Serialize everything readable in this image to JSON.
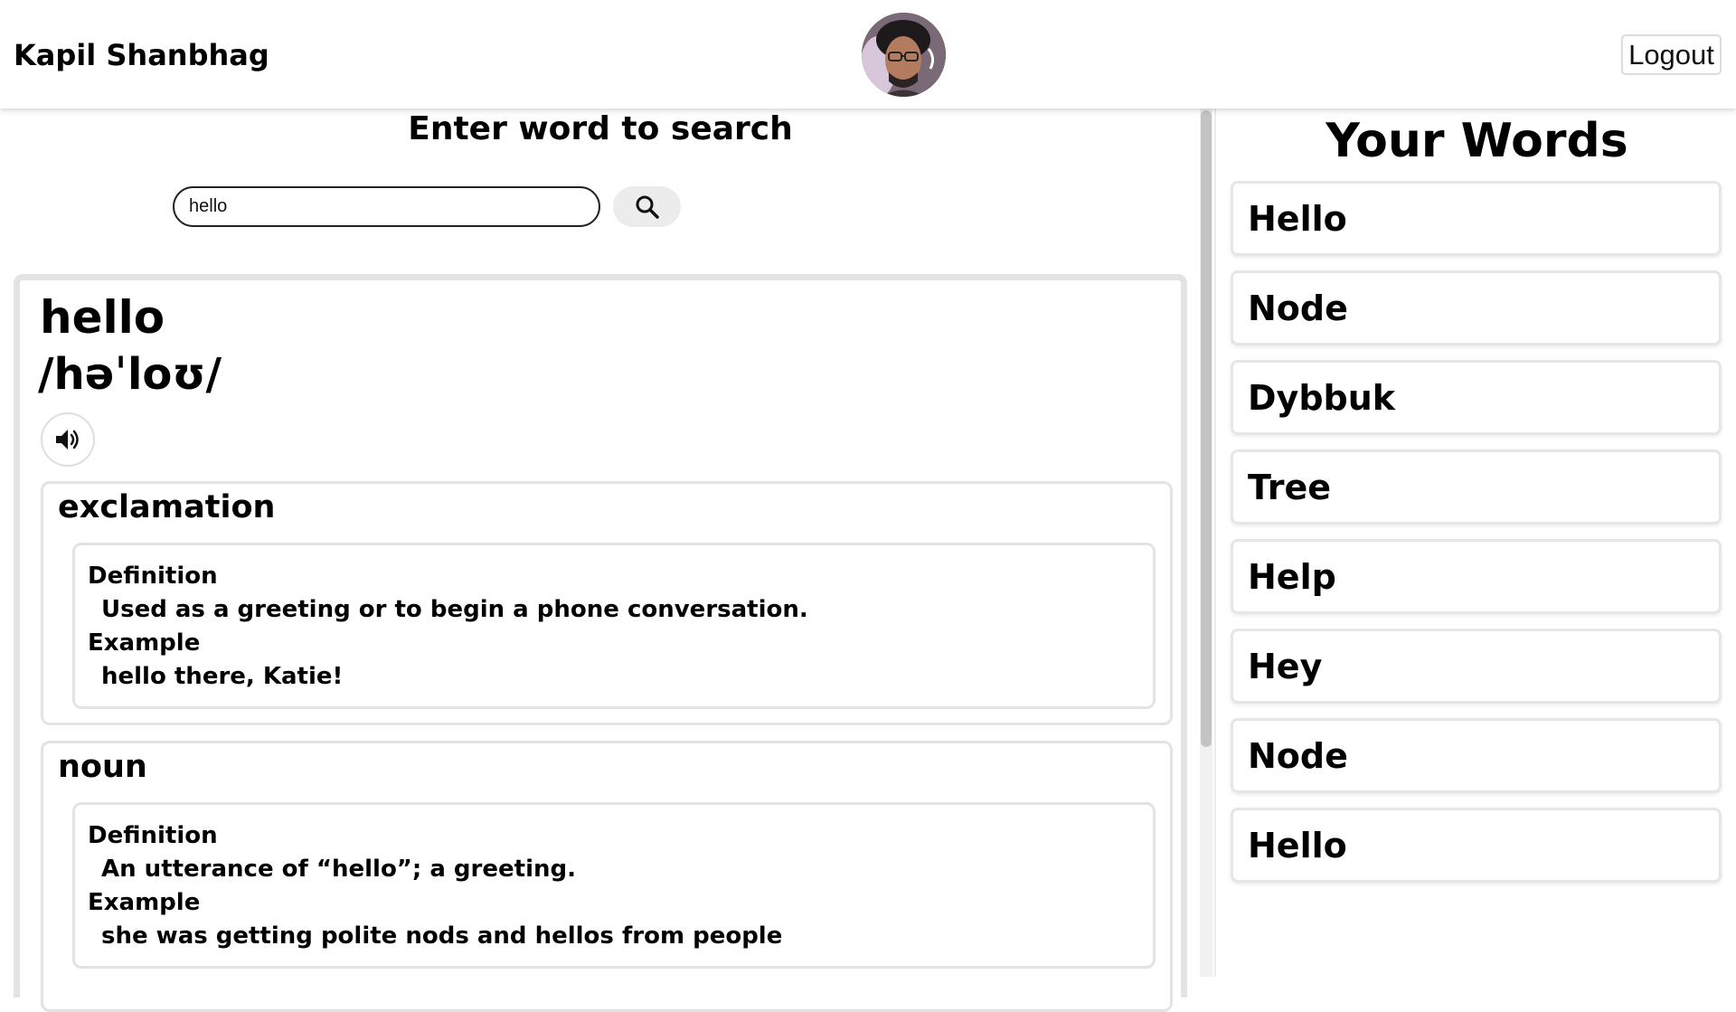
{
  "header": {
    "user_name": "Kapil Shanbhag",
    "logout_label": "Logout"
  },
  "search": {
    "title": "Enter word to search",
    "value": "hello",
    "button_icon": "search-icon"
  },
  "result": {
    "word": "hello",
    "phonetic": "/həˈloʊ/",
    "audio_icon": "speaker-icon",
    "meanings": [
      {
        "part_of_speech": "exclamation",
        "definition_label": "Definition",
        "definition": "Used as a greeting or to begin a phone conversation.",
        "example_label": "Example",
        "example": "hello there, Katie!"
      },
      {
        "part_of_speech": "noun",
        "definition_label": "Definition",
        "definition": "An utterance of “hello”; a greeting.",
        "example_label": "Example",
        "example": "she was getting polite nods and hellos from people"
      }
    ]
  },
  "your_words": {
    "title": "Your Words",
    "items": [
      {
        "label": "Hello"
      },
      {
        "label": "Node"
      },
      {
        "label": "Dybbuk"
      },
      {
        "label": "Tree"
      },
      {
        "label": "Help"
      },
      {
        "label": "Hey"
      },
      {
        "label": "Node"
      },
      {
        "label": "Hello"
      }
    ]
  }
}
